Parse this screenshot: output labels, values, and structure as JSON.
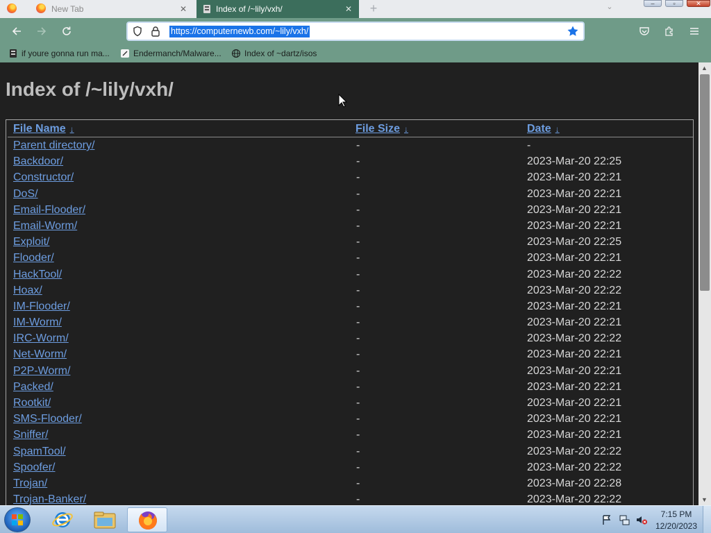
{
  "browser": {
    "tabs": [
      {
        "title": "New Tab",
        "active": false
      },
      {
        "title": "Index of /~lily/vxh/",
        "active": true
      }
    ],
    "url": "https://computernewb.com/~lily/vxh/",
    "bookmarks": [
      {
        "label": "if youre gonna run ma...",
        "icon": "server-icon"
      },
      {
        "label": "Endermanch/Malware...",
        "icon": "github-icon"
      },
      {
        "label": "Index of ~dartz/isos",
        "icon": "globe-icon"
      }
    ],
    "accent_colors": {
      "toolbar": "#6f9b88",
      "active_tab": "#3c6e5c",
      "link": "#6d9de0"
    }
  },
  "page": {
    "title": "Index of /~lily/vxh/",
    "columns": {
      "name": "File Name",
      "size": "File Size",
      "date": "Date",
      "sort_indicator": "↓"
    },
    "rows": [
      {
        "name": "Parent directory/",
        "size": "-",
        "date": "-"
      },
      {
        "name": "Backdoor/",
        "size": "-",
        "date": "2023-Mar-20 22:25"
      },
      {
        "name": "Constructor/",
        "size": "-",
        "date": "2023-Mar-20 22:21"
      },
      {
        "name": "DoS/",
        "size": "-",
        "date": "2023-Mar-20 22:21"
      },
      {
        "name": "Email-Flooder/",
        "size": "-",
        "date": "2023-Mar-20 22:21"
      },
      {
        "name": "Email-Worm/",
        "size": "-",
        "date": "2023-Mar-20 22:21"
      },
      {
        "name": "Exploit/",
        "size": "-",
        "date": "2023-Mar-20 22:25"
      },
      {
        "name": "Flooder/",
        "size": "-",
        "date": "2023-Mar-20 22:21"
      },
      {
        "name": "HackTool/",
        "size": "-",
        "date": "2023-Mar-20 22:22"
      },
      {
        "name": "Hoax/",
        "size": "-",
        "date": "2023-Mar-20 22:22"
      },
      {
        "name": "IM-Flooder/",
        "size": "-",
        "date": "2023-Mar-20 22:21"
      },
      {
        "name": "IM-Worm/",
        "size": "-",
        "date": "2023-Mar-20 22:21"
      },
      {
        "name": "IRC-Worm/",
        "size": "-",
        "date": "2023-Mar-20 22:22"
      },
      {
        "name": "Net-Worm/",
        "size": "-",
        "date": "2023-Mar-20 22:21"
      },
      {
        "name": "P2P-Worm/",
        "size": "-",
        "date": "2023-Mar-20 22:21"
      },
      {
        "name": "Packed/",
        "size": "-",
        "date": "2023-Mar-20 22:21"
      },
      {
        "name": "Rootkit/",
        "size": "-",
        "date": "2023-Mar-20 22:21"
      },
      {
        "name": "SMS-Flooder/",
        "size": "-",
        "date": "2023-Mar-20 22:21"
      },
      {
        "name": "Sniffer/",
        "size": "-",
        "date": "2023-Mar-20 22:21"
      },
      {
        "name": "SpamTool/",
        "size": "-",
        "date": "2023-Mar-20 22:22"
      },
      {
        "name": "Spoofer/",
        "size": "-",
        "date": "2023-Mar-20 22:22"
      },
      {
        "name": "Trojan/",
        "size": "-",
        "date": "2023-Mar-20 22:28"
      },
      {
        "name": "Trojan-Banker/",
        "size": "-",
        "date": "2023-Mar-20 22:22"
      }
    ]
  },
  "taskbar": {
    "apps": [
      "internet-explorer-icon",
      "file-explorer-icon",
      "firefox-icon"
    ],
    "clock_time": "7:15 PM",
    "clock_date": "12/20/2023"
  }
}
